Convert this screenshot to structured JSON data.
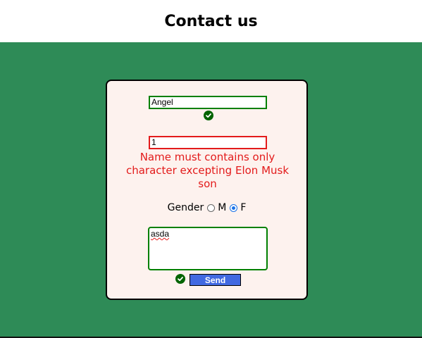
{
  "header": {
    "title": "Contact us"
  },
  "form": {
    "name_value": "Angel",
    "second_value": "1",
    "error_message": "Name must contains only character excepting Elon Musk son",
    "gender_label": "Gender",
    "gender_options": [
      {
        "label": "M",
        "checked": false
      },
      {
        "label": "F",
        "checked": true
      }
    ],
    "message_value": "asda",
    "send_label": "Send"
  },
  "colors": {
    "page_background": "#2e8b57",
    "card_background": "#fdf2ee",
    "valid_border": "#008000",
    "invalid_border": "#e31b1b",
    "error_text": "#e31b1b",
    "send_button": "#4169e1",
    "check_icon": "#006400"
  },
  "icons": {
    "name_status": "check-circle-icon",
    "message_status": "check-circle-icon"
  }
}
